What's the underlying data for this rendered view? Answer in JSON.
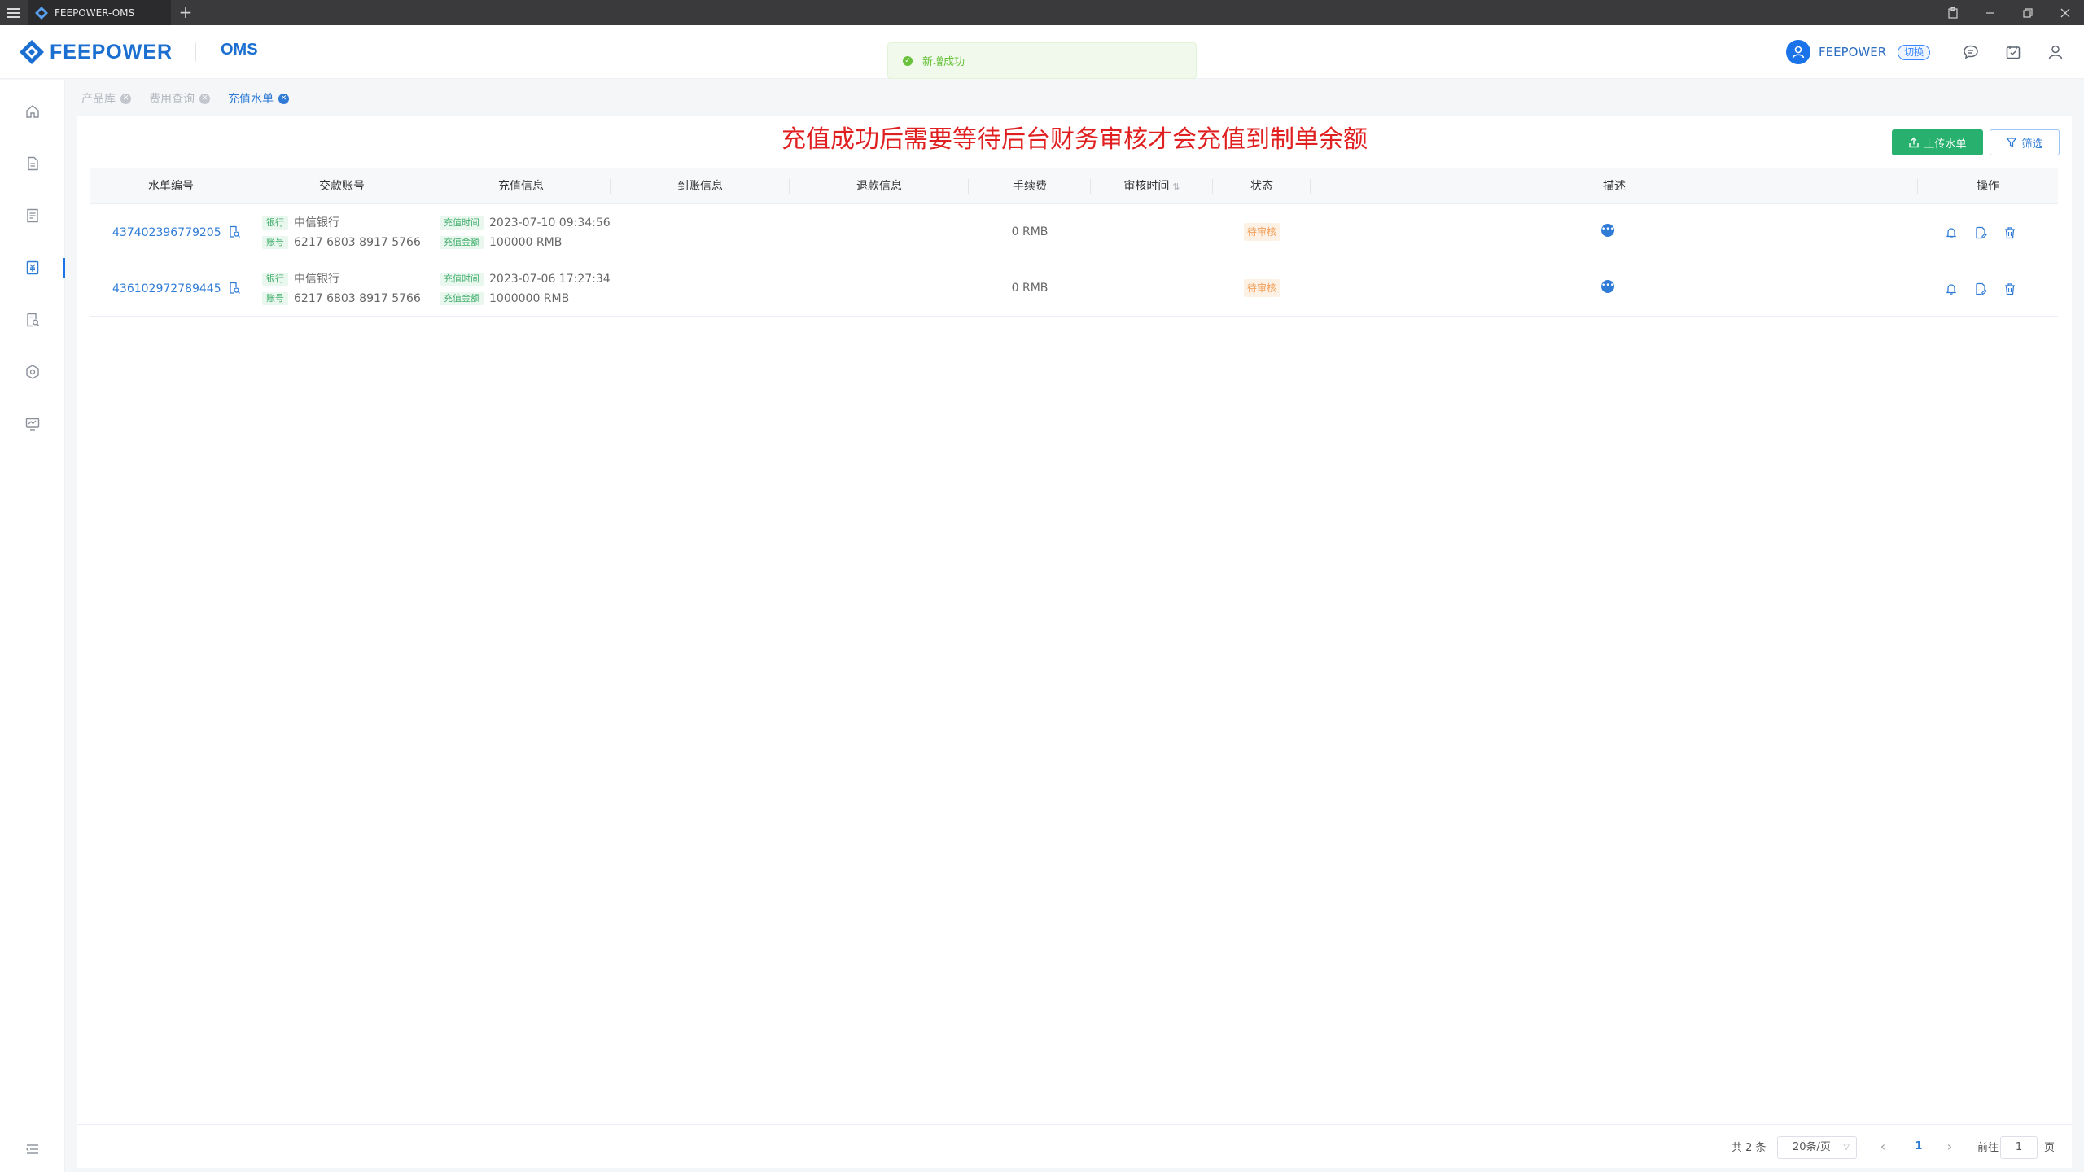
{
  "app": {
    "tab_title": "FEEPOWER-OMS",
    "new_tab": "+",
    "logo_text": "FEEPOWER",
    "module": "OMS",
    "user_name": "FEEPOWER",
    "switch_label": "切换"
  },
  "toast": {
    "text": "新增成功"
  },
  "breadcrumbs": [
    "产品库",
    "费用查询",
    "充值水单"
  ],
  "notice": "充值成功后需要等待后台财务审核才会充值到制单余额",
  "buttons": {
    "upload": "上传水单",
    "filter": "筛选"
  },
  "columns": [
    "水单编号",
    "交款账号",
    "充值信息",
    "到账信息",
    "退款信息",
    "手续费",
    "审核时间",
    "状态",
    "描述",
    "操作"
  ],
  "labels": {
    "bank": "银行",
    "account": "账号",
    "recharge_time": "充值时间",
    "recharge_amount": "充值金额"
  },
  "rows": [
    {
      "order_no": "437402396779205",
      "bank": "中信银行",
      "account": "6217 6803 8917 5766",
      "time": "2023-07-10 09:34:56",
      "amount": "100000 RMB",
      "fee": "0 RMB",
      "status": "待审核"
    },
    {
      "order_no": "436102972789445",
      "bank": "中信银行",
      "account": "6217 6803 8917 5766",
      "time": "2023-07-06 17:27:34",
      "amount": "1000000 RMB",
      "fee": "0 RMB",
      "status": "待审核"
    }
  ],
  "pagination": {
    "total": "共 2 条",
    "page_size": "20条/页",
    "current_page": "1",
    "goto_label": "前往",
    "goto_value": "1",
    "page_suffix": "页"
  },
  "colors": {
    "primary": "#2f7bd6",
    "success": "#27b06e",
    "warning": "#f2a25c",
    "danger": "#e02020"
  }
}
